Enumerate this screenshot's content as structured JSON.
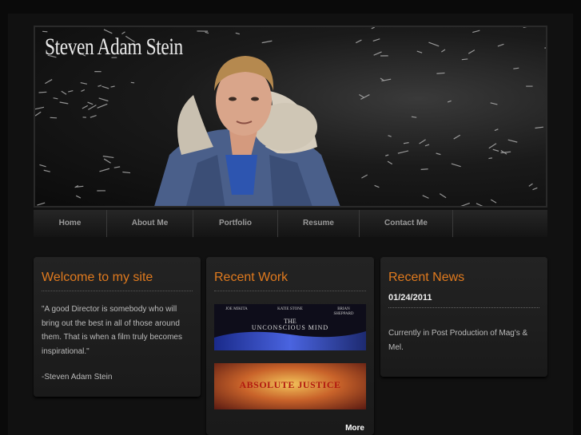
{
  "site": {
    "title": "Steven Adam Stein"
  },
  "nav": {
    "items": [
      {
        "label": "Home"
      },
      {
        "label": "About Me"
      },
      {
        "label": "Portfolio"
      },
      {
        "label": "Resume"
      },
      {
        "label": "Contact Me"
      }
    ]
  },
  "welcome": {
    "heading": "Welcome to my site",
    "quote": "\"A good Director is somebody who will bring out the best in all of those around them. That is when a film truly becomes inspirational.\"",
    "signature": "-Steven Adam Stein"
  },
  "recent_work": {
    "heading": "Recent Work",
    "items": [
      {
        "credits": [
          "JOE MIKITA",
          "KATIE STONE",
          "BRIAN SHEPPARD"
        ],
        "title_line1": "THE",
        "title_line2": "UNCONSCIOUS MIND"
      },
      {
        "title": "ABSOLUTE JUSTICE"
      }
    ],
    "more_label": "More"
  },
  "recent_news": {
    "heading": "Recent News",
    "date": "01/24/2011",
    "text": "Currently in Post Production of Mag's & Mel."
  },
  "colors": {
    "accent": "#e07a1e",
    "background": "#0a0a0a"
  }
}
